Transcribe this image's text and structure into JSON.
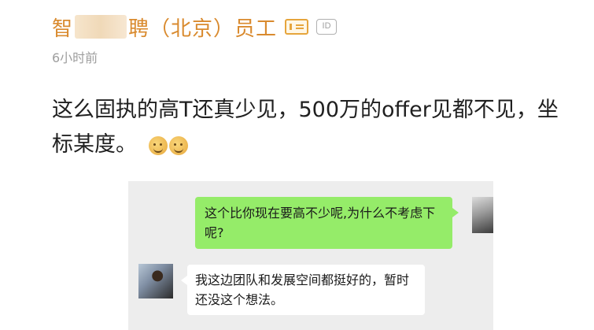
{
  "author": {
    "name_prefix": "智",
    "name_suffix": "聘（北京）员工",
    "verified_icon": "verified-badge-icon",
    "id_badge": "ID"
  },
  "post": {
    "time": "6小时前",
    "text": "这么固执的高T还真少见，500万的offer见都不见，坐标某度。",
    "emoji_icon": "smirk-emoji-icon"
  },
  "chat": {
    "sent_message": "这个比你现在要高不少呢,为什么不考虑下呢?",
    "received_message": "我这边团队和发展空间都挺好的，暂时还没这个想法。"
  },
  "colors": {
    "name": "#d98a2e",
    "sent_bubble": "#95ec69",
    "chat_bg": "#ededed"
  }
}
